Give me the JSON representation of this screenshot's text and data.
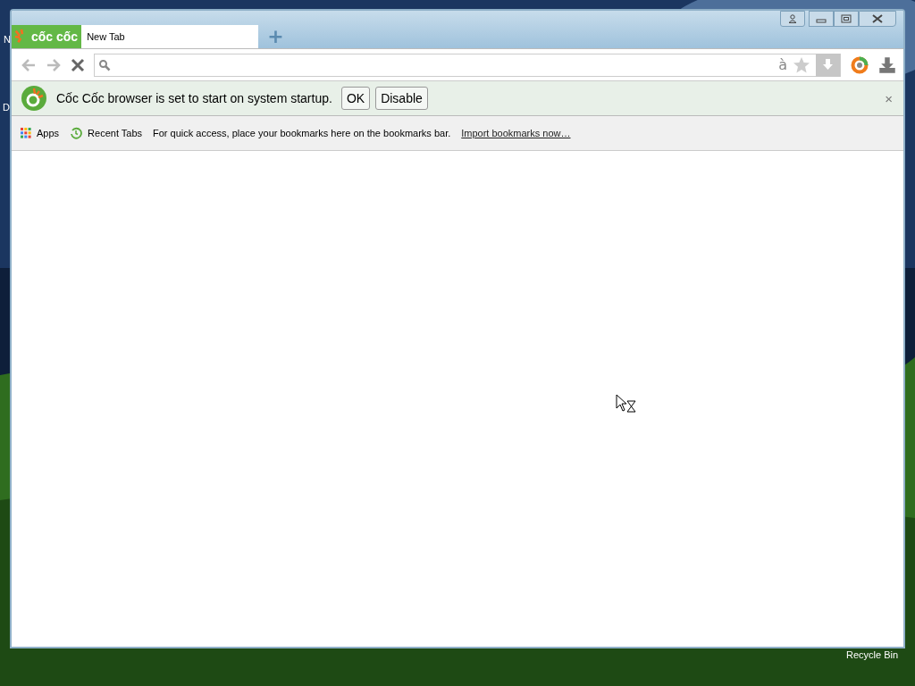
{
  "desktop": {
    "icons": [
      {
        "label": "N"
      },
      {
        "label": "D"
      },
      {
        "label": "Recycle Bin"
      }
    ]
  },
  "window": {
    "logo": "cốc cốc",
    "tabs": [
      {
        "title": "New Tab",
        "selected": true
      }
    ],
    "new_tab": "+",
    "loading": true,
    "address": {
      "input_glyph": "à"
    },
    "infobar": {
      "message": "Cốc Cốc browser is set to start on system startup.",
      "buttons": [
        "OK",
        "Disable"
      ],
      "close": "×"
    },
    "bookmarks": {
      "items": [
        {
          "kind": "apps",
          "label": "Apps"
        },
        {
          "kind": "history",
          "label": "Recent Tabs"
        }
      ],
      "hint": "For quick access, place your bookmarks here on the bookmarks bar.",
      "link": "Import bookmarks now…"
    },
    "busy_cursor": true
  }
}
